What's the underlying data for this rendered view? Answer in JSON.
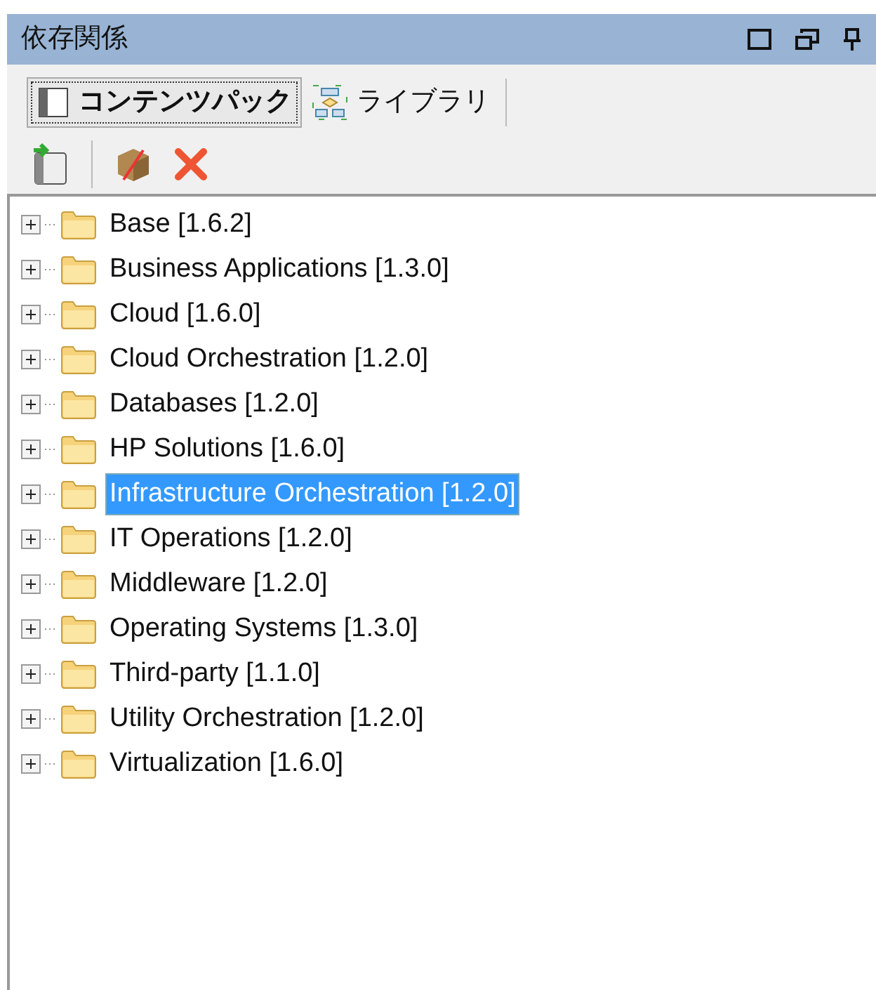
{
  "panel": {
    "title": "依存関係"
  },
  "tabs": [
    {
      "label": "コンテンツパック",
      "selected": true
    },
    {
      "label": "ライブラリ",
      "selected": false
    }
  ],
  "tree": [
    {
      "label": "Base [1.6.2]",
      "expanded": false,
      "selected": false
    },
    {
      "label": "Business Applications [1.3.0]",
      "expanded": false,
      "selected": false
    },
    {
      "label": "Cloud [1.6.0]",
      "expanded": false,
      "selected": false
    },
    {
      "label": "Cloud Orchestration [1.2.0]",
      "expanded": false,
      "selected": false
    },
    {
      "label": "Databases [1.2.0]",
      "expanded": false,
      "selected": false
    },
    {
      "label": "HP Solutions [1.6.0]",
      "expanded": false,
      "selected": false
    },
    {
      "label": "Infrastructure Orchestration [1.2.0]",
      "expanded": false,
      "selected": true
    },
    {
      "label": "IT Operations [1.2.0]",
      "expanded": false,
      "selected": false
    },
    {
      "label": "Middleware [1.2.0]",
      "expanded": false,
      "selected": false
    },
    {
      "label": "Operating Systems [1.3.0]",
      "expanded": false,
      "selected": false
    },
    {
      "label": "Third-party [1.1.0]",
      "expanded": false,
      "selected": false
    },
    {
      "label": "Utility Orchestration [1.2.0]",
      "expanded": false,
      "selected": false
    },
    {
      "label": "Virtualization [1.6.0]",
      "expanded": false,
      "selected": false
    }
  ]
}
